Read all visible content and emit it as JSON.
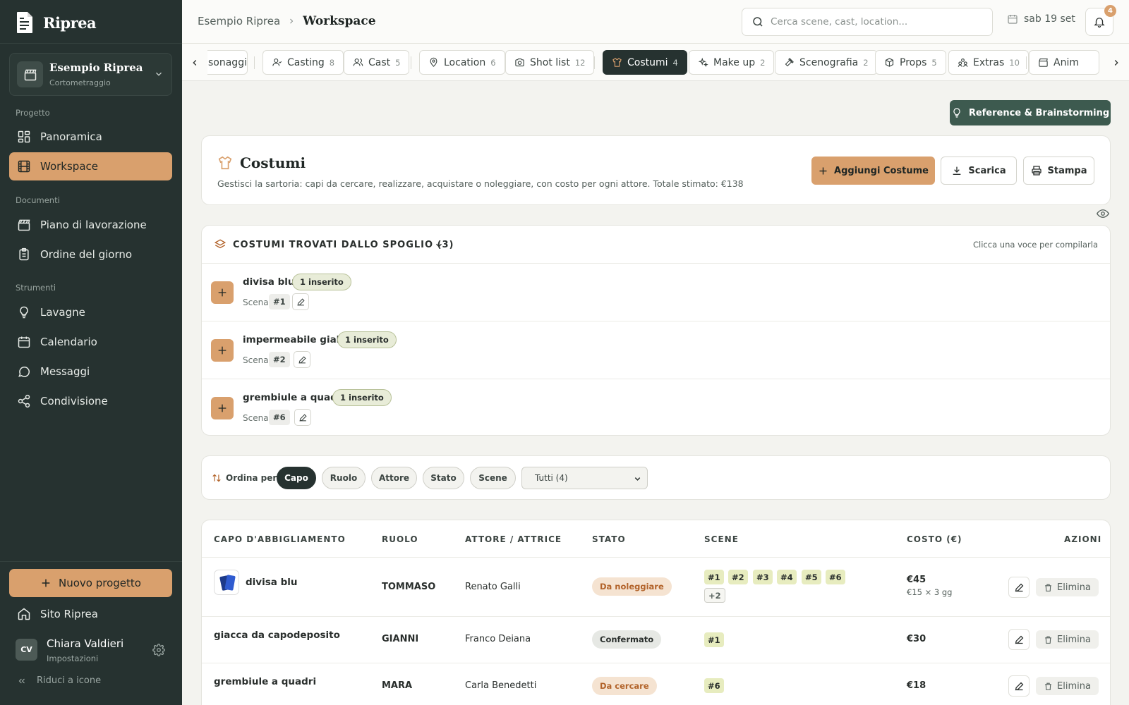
{
  "app": {
    "name": "Riprea"
  },
  "project": {
    "name": "Esempio Riprea",
    "type": "Cortometraggio"
  },
  "sidebar": {
    "sections": {
      "progetto": "Progetto",
      "documenti": "Documenti",
      "strumenti": "Strumenti"
    },
    "items": {
      "panoramica": "Panoramica",
      "workspace": "Workspace",
      "piano": "Piano di lavorazione",
      "ordine": "Ordine del giorno",
      "lavagne": "Lavagne",
      "calendario": "Calendario",
      "messaggi": "Messaggi",
      "condivisione": "Condivisione"
    },
    "new_project": "Nuovo progetto",
    "site": "Sito Riprea",
    "user": {
      "initials": "CV",
      "name": "Chiara Valdieri",
      "sub": "Impostazioni"
    },
    "collapse": "Riduci a icone"
  },
  "topbar": {
    "breadcrumb": {
      "parent": "Esempio Riprea",
      "current": "Workspace"
    },
    "search_placeholder": "Cerca scene, cast, location...",
    "date": "sab 19 set",
    "notifications": "4"
  },
  "tabs": [
    {
      "label": "sonaggi",
      "count": ""
    },
    {
      "label": "Casting",
      "count": "8"
    },
    {
      "label": "Cast",
      "count": "5"
    },
    {
      "label": "Location",
      "count": "6"
    },
    {
      "label": "Shot list",
      "count": "12"
    },
    {
      "label": "Costumi",
      "count": "4",
      "active": true
    },
    {
      "label": "Make up",
      "count": "2"
    },
    {
      "label": "Scenografia",
      "count": "2"
    },
    {
      "label": "Props",
      "count": "5"
    },
    {
      "label": "Extras",
      "count": "10"
    },
    {
      "label": "Anim",
      "count": ""
    }
  ],
  "reference_button": "Reference & Brainstorming",
  "header": {
    "title": "Costumi",
    "description": "Gestisci la sartoria: capi da cercare, realizzare, acquistare o noleggiare, con costo per ogni attore. Totale stimato: €138",
    "add": "Aggiungi Costume",
    "download": "Scarica",
    "print": "Stampa"
  },
  "spoglio": {
    "title": "COSTUMI TROVATI DALLO SPOGLIO (3)",
    "hint": "Clicca una voce per compilarla",
    "scena_label": "Scena",
    "items": [
      {
        "name": "divisa blu",
        "badge": "1 inserito",
        "scene": "#1"
      },
      {
        "name": "impermeabile giallo",
        "badge": "1 inserito",
        "scene": "#2"
      },
      {
        "name": "grembiule a quadri",
        "badge": "1 inserito",
        "scene": "#6"
      }
    ]
  },
  "sort": {
    "label": "Ordina per",
    "options": [
      "Capo",
      "Ruolo",
      "Attore",
      "Stato",
      "Scene"
    ],
    "active": "Capo",
    "filter": "Tutti (4)"
  },
  "table": {
    "headers": [
      "CAPO D'ABBIGLIAMENTO",
      "RUOLO",
      "ATTORE / ATTRICE",
      "STATO",
      "SCENE",
      "COSTO (€)",
      "AZIONI"
    ],
    "delete_label": "Elimina",
    "rows": [
      {
        "name": "divisa blu",
        "role": "TOMMASO",
        "actor": "Renato Galli",
        "status": "Da noleggiare",
        "status_color": "#b2632a",
        "scenes": [
          "#1",
          "#2",
          "#3",
          "#4",
          "#5",
          "#6"
        ],
        "more": "+2",
        "cost": "€45",
        "cost_detail": "€15 × 3 gg"
      },
      {
        "name": "giacca da capodeposito",
        "role": "GIANNI",
        "actor": "Franco Deiana",
        "status": "Confermato",
        "status_color": "#2a2f2d",
        "scenes": [
          "#1"
        ],
        "cost": "€30"
      },
      {
        "name": "grembiule a quadri",
        "role": "MARA",
        "actor": "Carla Benedetti",
        "status": "Da cercare",
        "status_color": "#b2632a",
        "scenes": [
          "#6"
        ],
        "cost": "€18"
      }
    ]
  },
  "colors": {
    "accent": "#d9a06d",
    "sidebar": "#263230",
    "dark_button": "#3d5a4f",
    "scene_tag": "#e7ecbf"
  }
}
